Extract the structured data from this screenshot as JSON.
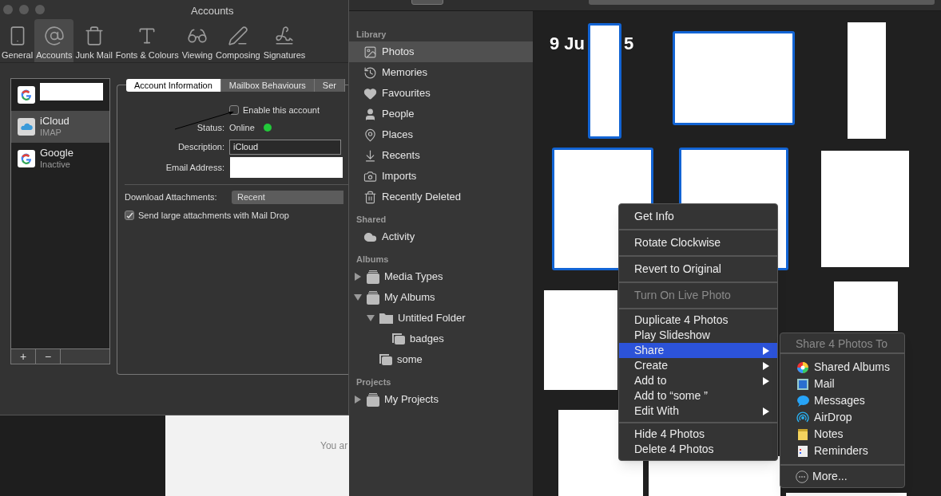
{
  "mail_prefs": {
    "window": {
      "title": "Accounts"
    },
    "toolbar": [
      {
        "label": "General",
        "selected": false
      },
      {
        "label": "Accounts",
        "selected": true
      },
      {
        "label": "Junk Mail",
        "selected": false
      },
      {
        "label": "Fonts & Colours",
        "selected": false
      },
      {
        "label": "Viewing",
        "selected": false
      },
      {
        "label": "Composing",
        "selected": false
      },
      {
        "label": "Signatures",
        "selected": false
      }
    ],
    "accounts": [
      {
        "kind": "google",
        "selected": false
      },
      {
        "kind": "icloud",
        "name": "iCloud",
        "type": "IMAP",
        "selected": true
      },
      {
        "kind": "google",
        "name": "Google",
        "type": "Inactive",
        "selected": false
      }
    ],
    "list_buttons": [
      "+",
      "−"
    ],
    "tabs": [
      {
        "label": "Account Information",
        "selected": true
      },
      {
        "label": "Mailbox Behaviours",
        "selected": false
      },
      {
        "label": "Ser",
        "selected": false
      }
    ],
    "enable_account": {
      "label": "Enable this account",
      "checked": false
    },
    "status": {
      "label": "Status:",
      "value": "Online",
      "online": true
    },
    "description": {
      "label": "Description:",
      "value": "iCloud"
    },
    "email": {
      "label": "Email Address:"
    },
    "download_attachments": {
      "label": "Download Attachments:",
      "value": "Recent"
    },
    "mail_drop": {
      "label": "Send large attachments with Mail Drop",
      "checked": true
    }
  },
  "background_window": {
    "text": "You ar"
  },
  "photos_app": {
    "sidebar": [
      {
        "heading": "Library",
        "items": [
          {
            "label": "Photos",
            "selected": true
          },
          {
            "label": "Memories",
            "selected": false
          },
          {
            "label": "Favourites",
            "selected": false
          },
          {
            "label": "People",
            "selected": false
          },
          {
            "label": "Places",
            "selected": false
          },
          {
            "label": "Recents",
            "selected": false
          },
          {
            "label": "Imports",
            "selected": false
          },
          {
            "label": "Recently Deleted",
            "selected": false
          }
        ]
      },
      {
        "heading": "Shared",
        "items": [
          {
            "label": "Activity",
            "selected": false
          }
        ]
      },
      {
        "heading": "Albums",
        "tree": [
          {
            "label": "Media Types",
            "kind": "stack",
            "expanded": false
          },
          {
            "label": "My Albums",
            "kind": "stack",
            "expanded": true,
            "children": [
              {
                "label": "Untitled Folder",
                "kind": "folder",
                "expanded": true,
                "children": [
                  {
                    "label": "badges",
                    "kind": "album"
                  }
                ]
              },
              {
                "label": "some",
                "kind": "album"
              }
            ]
          }
        ]
      },
      {
        "heading": "Projects",
        "tree": [
          {
            "label": "My Projects",
            "kind": "stack",
            "expanded": false
          }
        ]
      }
    ],
    "date_parts": [
      "9 Ju",
      "5"
    ],
    "photos": [
      {
        "selected": true
      },
      {
        "selected": true
      },
      {
        "selected": false
      },
      {
        "selected": true
      },
      {
        "selected": true
      },
      {
        "selected": false
      },
      {
        "selected": false
      },
      {
        "selected": false
      },
      {
        "selected": false
      },
      {
        "selected": false
      },
      {
        "selected": false
      }
    ],
    "context_menu": [
      [
        {
          "label": "Get Info",
          "disabled": false
        }
      ],
      [
        {
          "label": "Rotate Clockwise",
          "disabled": false
        }
      ],
      [
        {
          "label": "Revert to Original",
          "disabled": false
        }
      ],
      [
        {
          "label": "Turn On Live Photo",
          "disabled": true
        }
      ],
      [
        {
          "label": "Duplicate 4 Photos",
          "disabled": false
        },
        {
          "label": "Play Slideshow",
          "disabled": false
        },
        {
          "label": "Share",
          "disabled": false,
          "submenu": true,
          "selected": true
        },
        {
          "label": "Create",
          "disabled": false,
          "submenu": true
        },
        {
          "label": "Add to",
          "disabled": false,
          "submenu": true
        },
        {
          "label": "Add to “some ”",
          "disabled": false
        },
        {
          "label": "Edit With",
          "disabled": false,
          "submenu": true
        }
      ],
      [
        {
          "label": "Hide 4 Photos",
          "disabled": false
        },
        {
          "label": "Delete 4 Photos",
          "disabled": false
        }
      ]
    ],
    "share_submenu": {
      "heading": "Share 4 Photos To",
      "items": [
        {
          "label": "Shared Albums"
        },
        {
          "label": "Mail"
        },
        {
          "label": "Messages"
        },
        {
          "label": "AirDrop"
        },
        {
          "label": "Notes"
        },
        {
          "label": "Reminders"
        }
      ],
      "more": "More..."
    }
  }
}
